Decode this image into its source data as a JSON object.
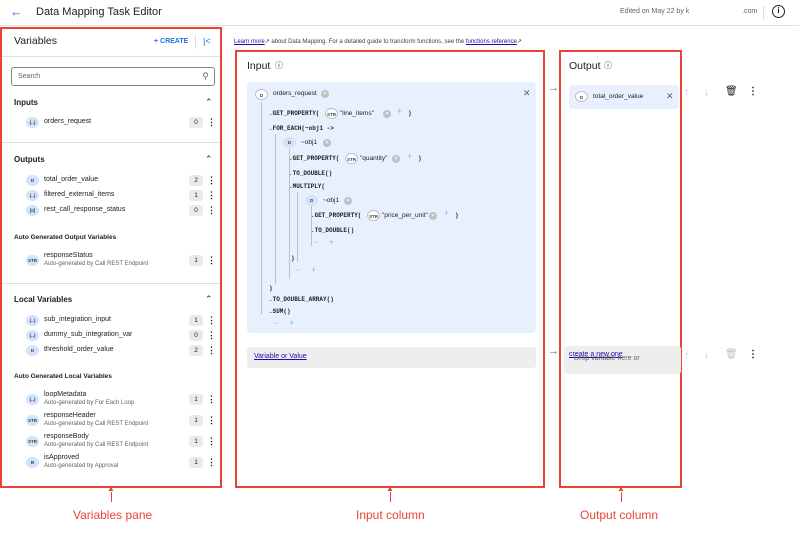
{
  "header": {
    "title": "Data Mapping Task Editor",
    "edited": "Edited on May 22 by k",
    "edited_domain": ".com"
  },
  "variables": {
    "title": "Variables",
    "create_label": "+ CREATE",
    "search_placeholder": "Search",
    "inputs_heading": "Inputs",
    "inputs": [
      {
        "chip": "{..}",
        "name": "orders_request",
        "count": "0"
      }
    ],
    "outputs_heading": "Outputs",
    "outputs": [
      {
        "chip": "D",
        "name": "total_order_value",
        "count": "2"
      },
      {
        "chip": "{..}",
        "name": "filtered_external_items",
        "count": "1"
      },
      {
        "chip": "[0]",
        "name": "rest_call_response_status",
        "count": "0"
      }
    ],
    "auto_output_heading": "Auto Generated Output Variables",
    "auto_outputs": [
      {
        "chip": "STR",
        "name": "responseStatus",
        "sub": "Auto-generated by Call REST Endpoint",
        "count": "1"
      }
    ],
    "local_heading": "Local Variables",
    "locals": [
      {
        "chip": "{..}",
        "name": "sub_integration_input",
        "count": "1"
      },
      {
        "chip": "{..}",
        "name": "dummy_sub_integration_var",
        "count": "0"
      },
      {
        "chip": "D",
        "name": "threshold_order_value",
        "count": "2"
      }
    ],
    "auto_local_heading": "Auto Generated Local Variables",
    "auto_locals": [
      {
        "chip": "{..}",
        "name": "loopMetadata",
        "sub": "Auto-generated by For Each Loop",
        "count": "1"
      },
      {
        "chip": "STR",
        "name": "responseHeader",
        "sub": "Auto-generated by Call REST Endpoint",
        "count": "1"
      },
      {
        "chip": "STR",
        "name": "responseBody",
        "sub": "Auto-generated by Call REST Endpoint",
        "count": "1"
      },
      {
        "chip": "B",
        "name": "isApproved",
        "sub": "Auto-generated by Approval",
        "count": "1"
      }
    ]
  },
  "learn": {
    "link": "Learn more",
    "middle": " about Data Mapping. For a detailed guide to transform functions, see the ",
    "link2": "functions reference"
  },
  "input": {
    "title": "Input",
    "root_chip": "D",
    "root_var": "orders_request",
    "f_get_property": ".GET_PROPERTY(",
    "str_chip": "STR",
    "line_items": "\"line_items\"",
    "close": ")",
    "for_each": ".FOR_EACH(~obj1 ->",
    "obj_chip": "D",
    "obj1": "~obj1",
    "quantity": "\"quantity\"",
    "to_double": ".TO_DOUBLE()",
    "multiply": ".MULTIPLY(",
    "price": "\"price_per_unit\"",
    "to_double_inner": ".TO_DOUBLE()",
    "to_double_array": ".TO_DOUBLE_ARRAY()",
    "sum": ".SUM()",
    "variable_or_value": "Variable or Value"
  },
  "output": {
    "title": "Output",
    "chip": "D",
    "var": "total_order_value",
    "drop_text": "Drop variable here or ",
    "drop_link": "create a new one"
  },
  "annotations": {
    "variables": "Variables pane",
    "input": "Input column",
    "output": "Output column"
  }
}
